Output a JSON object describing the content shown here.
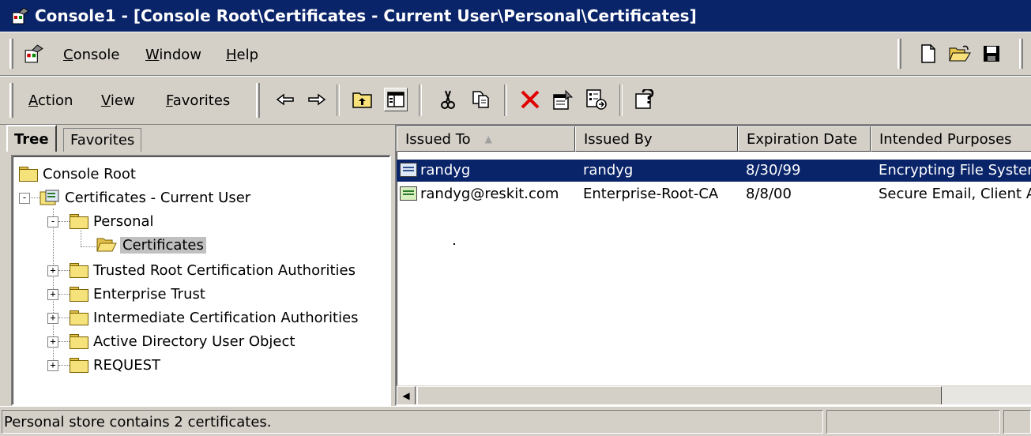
{
  "window": {
    "title": "Console1 - [Console Root\\Certificates - Current User\\Personal\\Certificates]"
  },
  "menubar": {
    "items": [
      {
        "label": "Console",
        "underline": "C"
      },
      {
        "label": "Window",
        "underline": "W"
      },
      {
        "label": "Help",
        "underline": "H"
      }
    ],
    "icons": [
      "new-icon",
      "open-icon",
      "save-icon"
    ]
  },
  "toolbar": {
    "menus": [
      {
        "label": "Action",
        "underline": "A"
      },
      {
        "label": "View",
        "underline": "V"
      },
      {
        "label": "Favorites",
        "underline": "F"
      }
    ],
    "buttons": [
      "back-icon",
      "forward-icon",
      "up-one-level-icon",
      "show-hide-tree-icon",
      "cut-icon",
      "copy-icon",
      "delete-icon",
      "properties-icon",
      "export-list-icon",
      "help-icon"
    ]
  },
  "tabs": [
    {
      "label": "Tree",
      "active": true
    },
    {
      "label": "Favorites",
      "active": false
    }
  ],
  "tree": {
    "nodes": [
      {
        "label": "Console Root",
        "level": 0,
        "expander": ""
      },
      {
        "label": "Certificates - Current User",
        "level": 0,
        "expander": "-"
      },
      {
        "label": "Personal",
        "level": 1,
        "expander": "-"
      },
      {
        "label": "Certificates",
        "level": 2,
        "expander": "",
        "selected": true
      },
      {
        "label": "Trusted Root Certification Authorities",
        "level": 1,
        "expander": "+"
      },
      {
        "label": "Enterprise Trust",
        "level": 1,
        "expander": "+"
      },
      {
        "label": "Intermediate Certification Authorities",
        "level": 1,
        "expander": "+"
      },
      {
        "label": "Active Directory User Object",
        "level": 1,
        "expander": "+"
      },
      {
        "label": "REQUEST",
        "level": 1,
        "expander": "+"
      }
    ]
  },
  "list": {
    "columns": [
      "Issued To",
      "Issued By",
      "Expiration Date",
      "Intended Purposes"
    ],
    "sort_column": "Issued To",
    "rows": [
      {
        "issued_to": "randyg",
        "issued_by": "randyg",
        "expiration": "8/30/99",
        "purposes": "Encrypting File Syster",
        "selected": true
      },
      {
        "issued_to": "randyg@reskit.com",
        "issued_by": "Enterprise-Root-CA",
        "expiration": "8/8/00",
        "purposes": "Secure Email, Client A",
        "selected": false
      }
    ]
  },
  "status": {
    "text": "Personal store contains 2 certificates."
  },
  "colors": {
    "titlebar": "#0a246a",
    "selection": "#0a246a",
    "face": "#d4d0c8"
  }
}
